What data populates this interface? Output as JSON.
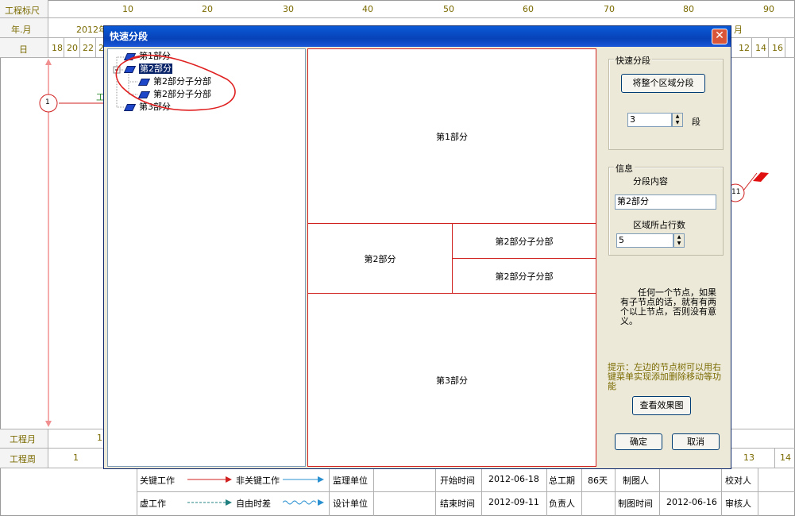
{
  "chart": {
    "scale_label": "工程标尺",
    "yearmonth_label": "年.月",
    "day_label": "日",
    "scale_ticks": [
      "10",
      "20",
      "30",
      "40",
      "50",
      "60",
      "70",
      "80",
      "90"
    ],
    "yearmonth_value": "2012年",
    "month_right": "月",
    "days_left": [
      "18",
      "20",
      "22",
      "2"
    ],
    "days_right": [
      "12",
      "14",
      "16"
    ],
    "node_1": "1",
    "node_11": "11",
    "work_label_fragment": "工",
    "month_row_label": "工程月",
    "month_row_value": "1",
    "week_row_label": "工程周",
    "week_row_values": [
      "1",
      "13",
      "14"
    ]
  },
  "legend": {
    "key_work": "关键工作",
    "nonkey_work": "非关键工作",
    "virtual_work": "虚工作",
    "free_float": "自由时差",
    "supervisor": "监理单位",
    "designer": "设计单位",
    "start_label": "开始时间",
    "start_value": "2012-06-18",
    "end_label": "结束时间",
    "end_value": "2012-09-11",
    "total_label": "总工期",
    "total_value": "86天",
    "owner_label": "负责人",
    "drawer_label": "制图人",
    "draw_time_label": "制图时间",
    "draw_time_value": "2012-06-16",
    "checker_label": "校对人",
    "reviewer_label": "审核人"
  },
  "dialog": {
    "title": "快速分段",
    "close": "✕",
    "tree": [
      {
        "label": "第1部分"
      },
      {
        "label": "第2部分"
      },
      {
        "label": "第2部分子分部"
      },
      {
        "label": "第2部分子分部"
      },
      {
        "label": "第3部分"
      }
    ],
    "preview": {
      "part1": "第1部分",
      "part2": "第2部分",
      "sub1": "第2部分子分部",
      "sub2": "第2部分子分部",
      "part3": "第3部分"
    },
    "quick_group": "快速分段",
    "split_button": "将整个区域分段",
    "segments_value": "3",
    "segments_unit": "段",
    "info_group": "信息",
    "content_label": "分段内容",
    "content_value": "第2部分",
    "rows_label": "区域所占行数",
    "rows_value": "5",
    "note": "任何一个节点，如果有子节点的话，就有有两个以上节点，否则没有意义。",
    "hint": "提示：左边的节点树可以用右键菜单实现添加删除移动等功能",
    "view_button": "查看效果图",
    "ok_button": "确定",
    "cancel_button": "取消"
  },
  "colors": {
    "accent": "#d02020",
    "title_bar": "#0842b8",
    "olive": "#7a6a00"
  }
}
